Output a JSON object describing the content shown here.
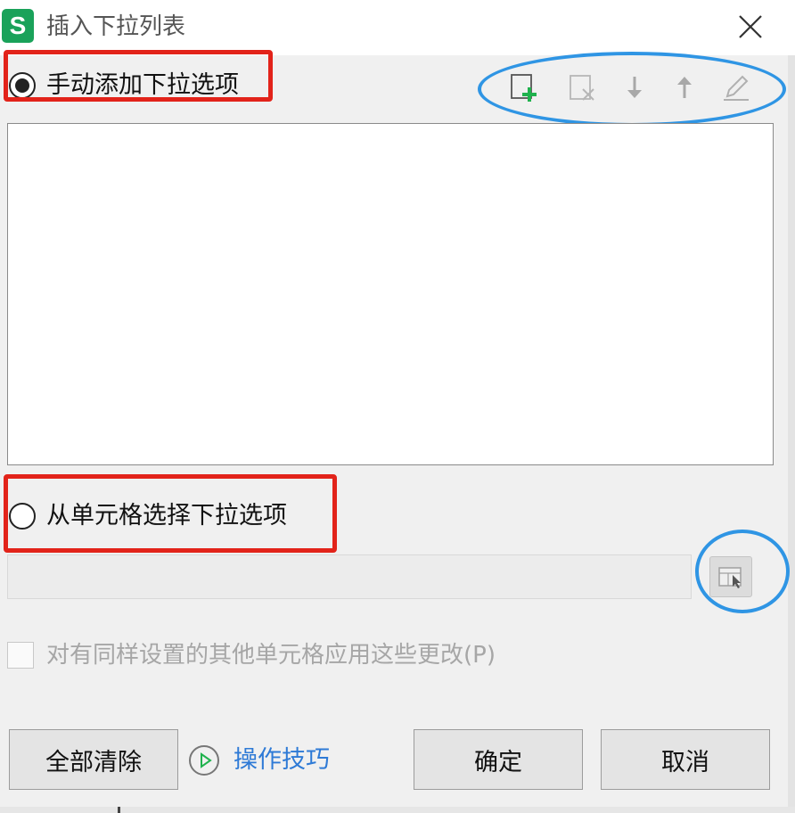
{
  "window": {
    "title": "插入下拉列表",
    "app_icon_letter": "S",
    "app_icon_color": "#1aa25a",
    "close_icon": "close-icon"
  },
  "option_manual": {
    "label": "手动添加下拉选项",
    "selected": true
  },
  "toolbar": {
    "items": [
      {
        "name": "add-item-icon",
        "enabled": true
      },
      {
        "name": "delete-item-icon",
        "enabled": false
      },
      {
        "name": "move-down-icon",
        "enabled": false
      },
      {
        "name": "move-up-icon",
        "enabled": false
      },
      {
        "name": "edit-pencil-icon",
        "enabled": false
      }
    ]
  },
  "option_from_cells": {
    "label": "从单元格选择下拉选项",
    "selected": false,
    "range_value": "",
    "range_select_icon": "range-select-icon"
  },
  "apply_to_same": {
    "label": "对有同样设置的其他单元格应用这些更改(P)",
    "checked": false,
    "enabled": false
  },
  "footer": {
    "clear_all_label": "全部清除",
    "tips_label": "操作技巧",
    "tips_icon": "play-circle-icon",
    "ok_label": "确定",
    "cancel_label": "取消"
  },
  "annotation_colors": {
    "red_highlight": "#e2231a",
    "blue_highlight": "#2f95e4"
  }
}
